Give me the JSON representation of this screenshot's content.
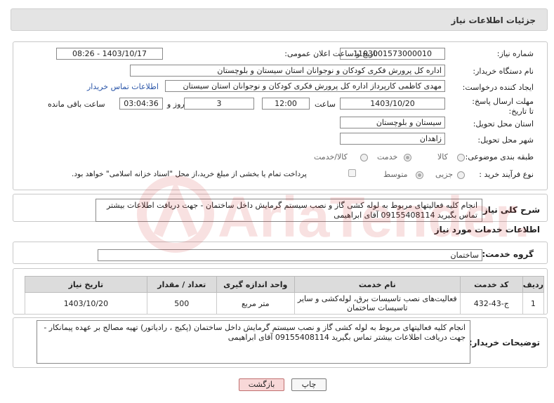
{
  "header": {
    "title": "جزئیات اطلاعات نیاز"
  },
  "form": {
    "need_number_label": "شماره نیاز:",
    "need_number": "1103001573000010",
    "announce_label": "تاریخ و ساعت اعلان عمومی:",
    "announce_value": "1403/10/17 - 08:26",
    "buyer_label": "نام دستگاه خریدار:",
    "buyer_value": "اداره کل پرورش فکری کودکان و نوجوانان استان سیستان و بلوچستان",
    "creator_label": "ایجاد کننده درخواست:",
    "creator_value": "مهدی کاظمی کارپرداز اداره کل پرورش فکری کودکان و نوجوانان استان سیستان",
    "contact_link": "اطلاعات تماس خریدار",
    "deadline_label": "مهلت ارسال پاسخ: تا تاریخ:",
    "deadline_date": "1403/10/20",
    "time_label": "ساعت",
    "deadline_time": "12:00",
    "days_value": "3",
    "days_label": "روز و",
    "remaining_time": "03:04:36",
    "remaining_label": "ساعت باقی مانده",
    "province_label": "استان محل تحویل:",
    "province_value": "سیستان و بلوچستان",
    "city_label": "شهر محل تحویل:",
    "city_value": "زاهدان",
    "category_label": "طبقه بندی موضوعی:",
    "category_options": [
      "کالا",
      "خدمت",
      "کالا/خدمت"
    ],
    "category_selected": "خدمت",
    "process_label": "نوع فرآیند خرید :",
    "process_options": [
      "جزیی",
      "متوسط"
    ],
    "process_selected": "متوسط",
    "payment_note": "پرداخت تمام یا بخشی از مبلغ خرید،از محل \"اسناد خزانه اسلامی\" خواهد بود."
  },
  "summary": {
    "label": "شرح کلی نیاز:",
    "text": "انجام کلیه فعالیتهای مربوط به لوله کشی گاز و نصب سیستم گرمایش داخل ساختمان  - جهت دریافت اطلاعات بیشتر تماس بگیرید 09155408114 آقای ابراهیمی"
  },
  "services": {
    "section_title": "اطلاعات خدمات مورد نیاز",
    "group_label": "گروه خدمت:",
    "group_value": "ساختمان",
    "table_headers": [
      "ردیف",
      "کد خدمت",
      "نام خدمت",
      "واحد اندازه گیری",
      "تعداد / مقدار",
      "تاریخ نیاز"
    ],
    "rows": [
      {
        "row": "1",
        "code": "ج-43-432",
        "name": "فعالیت‌های نصب تاسیسات برق، لوله‌کشی و سایر تاسیسات ساختمان",
        "unit": "متر مربع",
        "qty": "500",
        "date": "1403/10/20"
      }
    ]
  },
  "buyer_notes": {
    "label": "توضیحات خریدار:",
    "text": "انجام کلیه فعالیتهای مربوط به لوله کشی گاز و نصب سیستم گرمایش داخل ساختمان (پکیج ، رادیاتور) تهیه مصالح بر عهده پیمانکار - جهت دریافت اطلاعات بیشتر تماس بگیرید 09155408114 آقای ابراهیمی"
  },
  "buttons": {
    "print": "چاپ",
    "back": "بازگشت"
  },
  "watermark_text": "AriaTender.neT",
  "colors": {
    "header_bg": "#e4e4e4",
    "link": "#2a55a8",
    "back_button_bg": "#f8d8d8",
    "watermark": "#d02020"
  }
}
